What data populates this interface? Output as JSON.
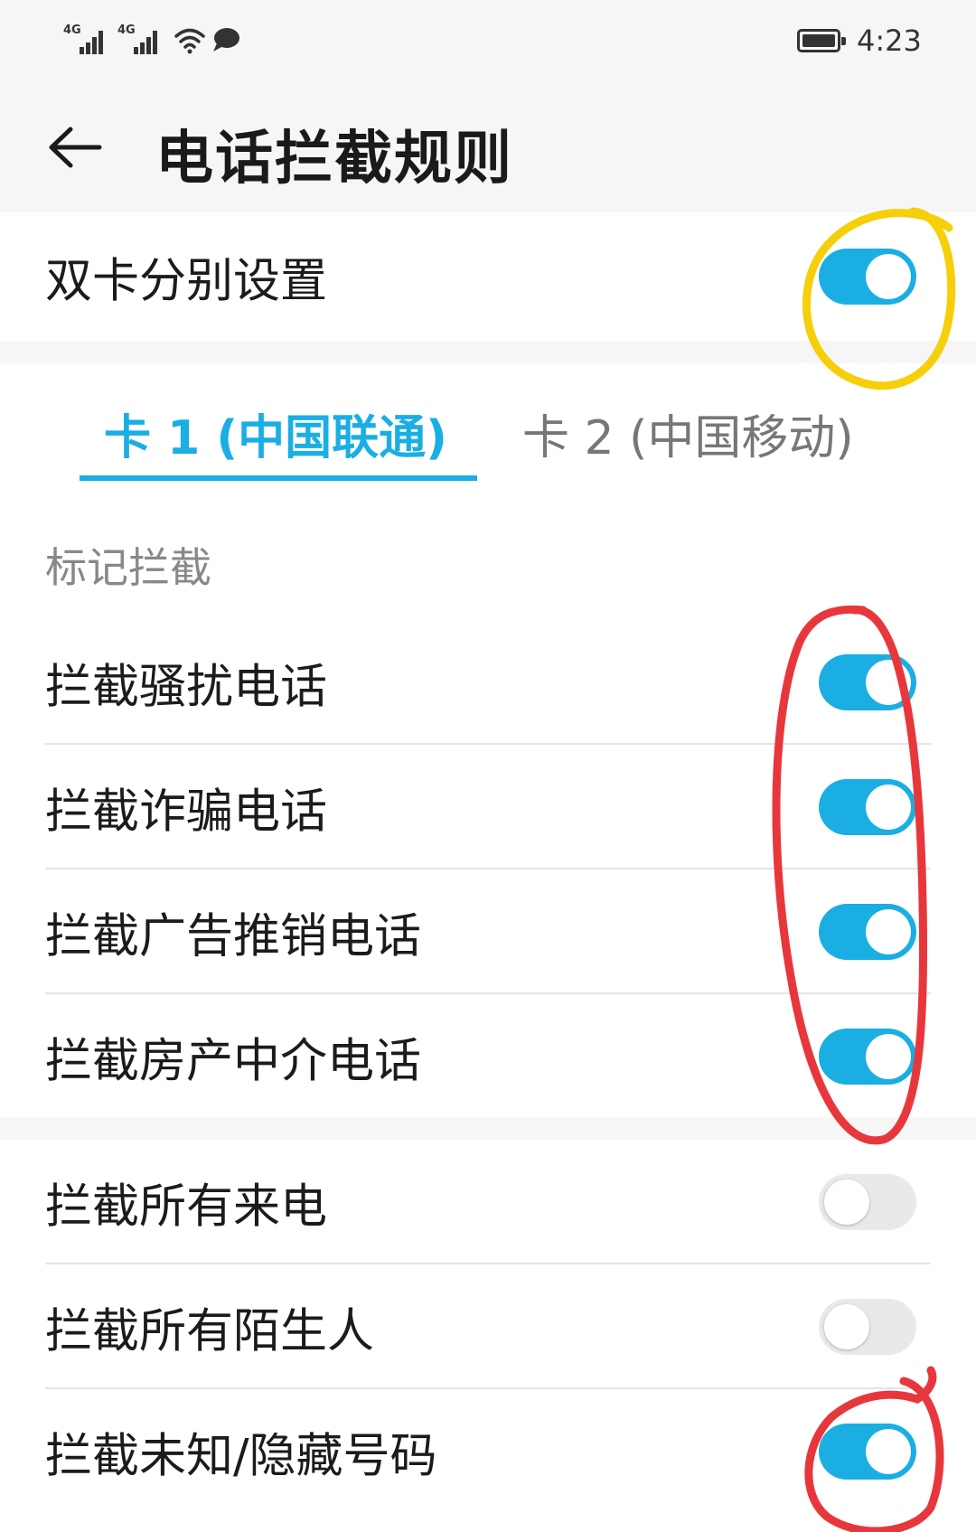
{
  "status_bar": {
    "sim1": "4G",
    "sim2": "4G",
    "time": "4:23"
  },
  "header": {
    "title": "电话拦截规则"
  },
  "dual_sim": {
    "label": "双卡分别设置",
    "enabled": true
  },
  "tabs": [
    {
      "label": "卡 1 (中国联通)",
      "selected": true
    },
    {
      "label": "卡 2 (中国移动)",
      "selected": false
    }
  ],
  "mark_section": {
    "title": "标记拦截",
    "items": [
      {
        "label": "拦截骚扰电话",
        "enabled": true
      },
      {
        "label": "拦截诈骗电话",
        "enabled": true
      },
      {
        "label": "拦截广告推销电话",
        "enabled": true
      },
      {
        "label": "拦截房产中介电话",
        "enabled": true
      }
    ]
  },
  "other_section": {
    "items": [
      {
        "label": "拦截所有来电",
        "enabled": false
      },
      {
        "label": "拦截所有陌生人",
        "enabled": false
      },
      {
        "label": "拦截未知/隐藏号码",
        "enabled": true
      }
    ]
  },
  "colors": {
    "accent": "#1aaee3",
    "switch_off": "#e9e9e9",
    "annotation_yellow": "#f5cf0a",
    "annotation_red": "#e8373c"
  }
}
